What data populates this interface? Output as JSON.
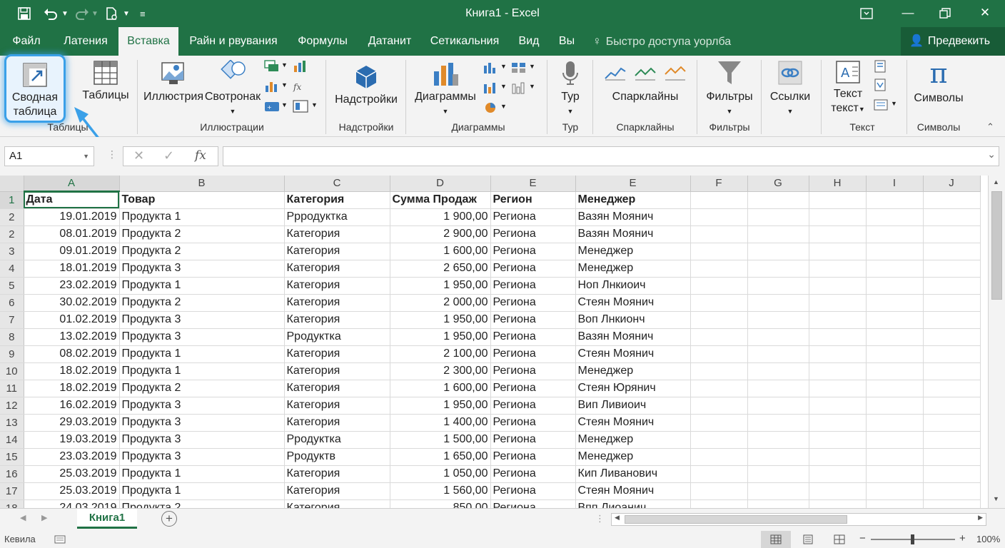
{
  "window": {
    "title": "Книга1  -  Excel",
    "colors": {
      "brand": "#207245",
      "highlight": "#3aa0e8"
    }
  },
  "quick_access": {
    "save_icon": "save-icon",
    "undo_icon": "undo-icon",
    "redo_icon": "redo-icon",
    "new_icon": "new-file-icon",
    "customize_icon": "customize-icon"
  },
  "tabs": [
    {
      "label": "Файл",
      "active": false
    },
    {
      "label": "Латения",
      "active": false
    },
    {
      "label": "Вставка",
      "active": true
    },
    {
      "label": "Райн и рвувания",
      "active": false
    },
    {
      "label": "Формулы",
      "active": false
    },
    {
      "label": "Датанит",
      "active": false
    },
    {
      "label": "Сетикальния",
      "active": false
    },
    {
      "label": "Вид",
      "active": false
    },
    {
      "label": "Вы",
      "active": false
    }
  ],
  "tell_me": "Быстро доступа уорлба",
  "share": "Предвекить",
  "ribbon": {
    "pivot_line1": "Сводная",
    "pivot_line2": "таблица",
    "tables": "Таблицы",
    "illustrations": "Иллюстрия",
    "smartart": "Свотронак",
    "addins": "Надстройки",
    "charts": "Диаграммы",
    "tour": "Тур",
    "sparklines": "Спарклайны",
    "filters": "Фильтры",
    "links": "Ссылки",
    "text_line1": "Текст",
    "text_line2": "текст",
    "symbols": "Символы",
    "groups": {
      "tables": "Таблицы",
      "illustrations": "Иллюстрации",
      "addins": "Надстройки",
      "charts": "Диаграммы",
      "tour": "Тур",
      "sparklines": "Спарклайны",
      "filters": "Фильтры",
      "text": "Текст",
      "symbols": "Символы"
    }
  },
  "formula_bar": {
    "name_box": "A1",
    "fx": "fx",
    "formula": ""
  },
  "sheet": {
    "columns": [
      "A",
      "B",
      "C",
      "D",
      "E",
      "E",
      "F",
      "G",
      "H",
      "I",
      "J"
    ],
    "header_row": {
      "num": "1",
      "cells": [
        "Дата",
        "Товар",
        "Категория",
        "Сумма Продаж",
        "Регион",
        "Менеджер"
      ]
    },
    "rows": [
      {
        "num": "2",
        "cells": [
          "19.01.2019",
          "Продукта 1",
          "Ррродуктка",
          "1 900,00",
          "Региона",
          "Вазян Моянич"
        ]
      },
      {
        "num": "2",
        "cells": [
          "08.01.2019",
          "Продукта 2",
          "Категория",
          "2 900,00",
          "Региона",
          "Вазян Моянич"
        ]
      },
      {
        "num": "3",
        "cells": [
          "09.01.2019",
          "Продукта 2",
          "Категория",
          "1 600,00",
          "Региона",
          "Менеджер"
        ]
      },
      {
        "num": "4",
        "cells": [
          "18.01.2019",
          "Продукта 3",
          "Категория",
          "2 650,00",
          "Региона",
          "Менеджер"
        ]
      },
      {
        "num": "5",
        "cells": [
          "23.02.2019",
          "Продукта 1",
          "Категория",
          "1 950,00",
          "Региона",
          "Ноп Лнкиоич"
        ]
      },
      {
        "num": "6",
        "cells": [
          "30.02.2019",
          "Продукта 2",
          "Категория",
          "2 000,00",
          "Региона",
          "Стеян Моянич"
        ]
      },
      {
        "num": "7",
        "cells": [
          "01.02.2019",
          "Продукта 3",
          "Категория",
          "1 950,00",
          "Региона",
          "Воп Лнкионч"
        ]
      },
      {
        "num": "8",
        "cells": [
          "13.02.2019",
          "Продукта 3",
          "Рродуктка",
          "1 950,00",
          "Региона",
          "Вазян Моянич"
        ]
      },
      {
        "num": "9",
        "cells": [
          "08.02.2019",
          "Продукта 1",
          "Категория",
          "2 100,00",
          "Региона",
          "Стеян Моянич"
        ]
      },
      {
        "num": "10",
        "cells": [
          "18.02.2019",
          "Продукта 1",
          "Категория",
          "2 300,00",
          "Региона",
          "Менеджер"
        ]
      },
      {
        "num": "11",
        "cells": [
          "18.02.2019",
          "Продукта 2",
          "Категория",
          "1 600,00",
          "Региона",
          "Стеян Юрянич"
        ]
      },
      {
        "num": "12",
        "cells": [
          "16.02.2019",
          "Продукта 3",
          "Категория",
          "1 950,00",
          "Региона",
          "Вип Ливиоич"
        ]
      },
      {
        "num": "13",
        "cells": [
          "29.03.2019",
          "Продукта 3",
          "Категория",
          "1 400,00",
          "Региона",
          "Стеян Моянич"
        ]
      },
      {
        "num": "14",
        "cells": [
          "19.03.2019",
          "Продукта 3",
          "Рродуктка",
          "1 500,00",
          "Региона",
          "Менеджер"
        ]
      },
      {
        "num": "15",
        "cells": [
          "23.03.2019",
          "Продукта 3",
          "Рродуктв",
          "1 650,00",
          "Региона",
          "Менеджер"
        ]
      },
      {
        "num": "16",
        "cells": [
          "25.03.2019",
          "Продукта 1",
          "Категория",
          "1 050,00",
          "Региона",
          "Кип Ливанович"
        ]
      },
      {
        "num": "17",
        "cells": [
          "25.03.2019",
          "Продукта 1",
          "Категория",
          "1 560,00",
          "Региона",
          "Стеян Моянич"
        ]
      },
      {
        "num": "18",
        "cells": [
          "24.03.2019",
          "Продукта 2",
          "Категория",
          "850,00",
          "Региона",
          "Впп Лиоанич"
        ]
      }
    ]
  },
  "sheet_tabs": {
    "active": "Книга1",
    "add": "+"
  },
  "status": {
    "mode": "Кевила",
    "zoom": "100%",
    "zoom_minus": "−",
    "zoom_plus": "+"
  }
}
